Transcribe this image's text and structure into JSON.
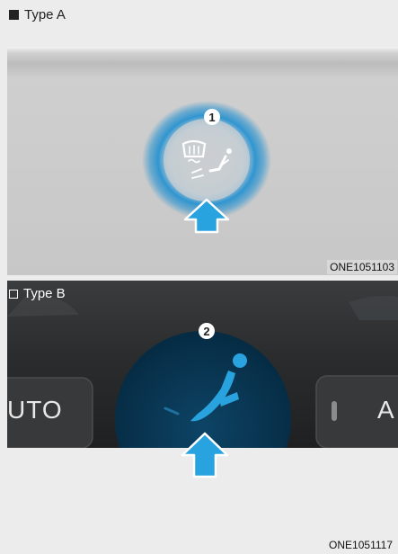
{
  "panel_a": {
    "type_label": "Type A",
    "callout_number": "1",
    "figure_code": "ONE1051103"
  },
  "panel_b": {
    "type_label": "Type B",
    "callout_number": "2",
    "left_button_text": "UTO",
    "right_button_text": "A"
  },
  "figure_code_bottom": "ONE1051117",
  "colors": {
    "glow_blue": "#1f8fd0",
    "arrow_blue": "#29a3e0",
    "dash_dark": "#2d2f31",
    "circle_navy": "#0a3550"
  },
  "icons": {
    "panel_a": "defrost-floor-airflow-icon",
    "panel_b": "seat-airflow-icon"
  }
}
